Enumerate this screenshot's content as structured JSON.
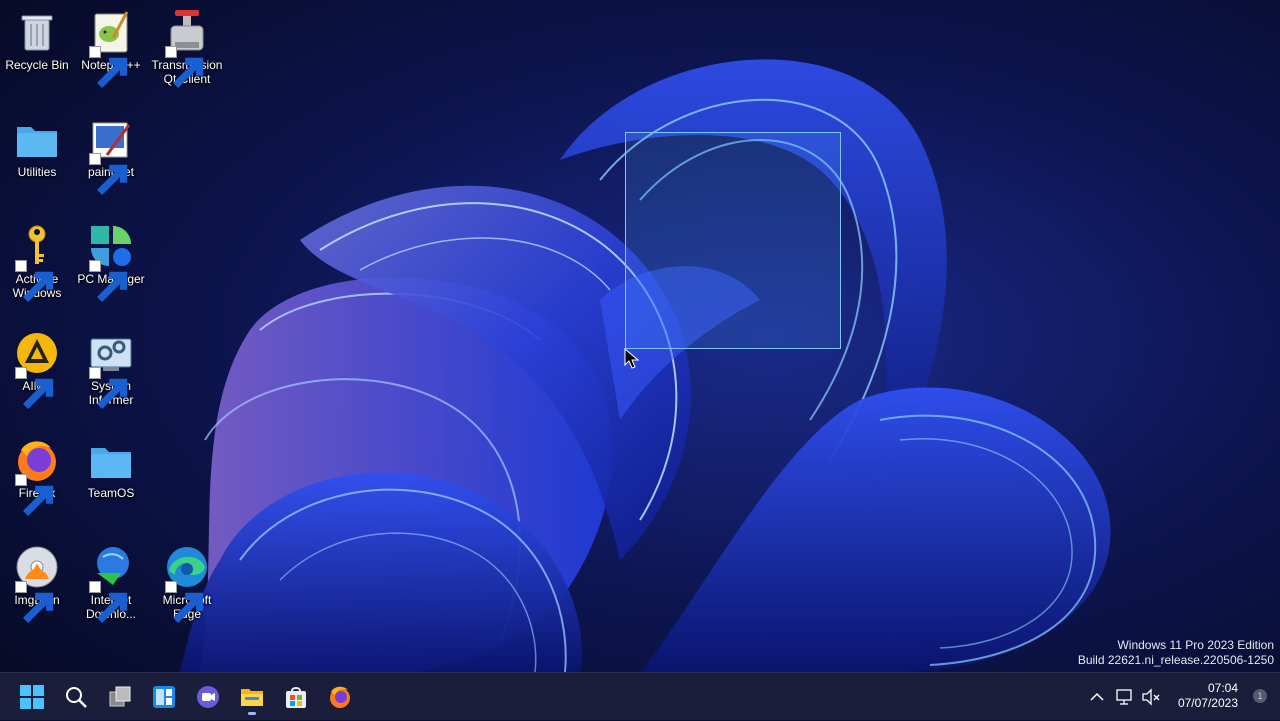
{
  "desktop": {
    "icons": [
      {
        "id": "recycle-bin",
        "label": "Recycle Bin",
        "icon": "recycle-bin-icon"
      },
      {
        "id": "notepadpp",
        "label": "Notepad++",
        "icon": "notepadpp-icon"
      },
      {
        "id": "transmission",
        "label": "Transmission Qt Client",
        "icon": "transmission-icon"
      },
      {
        "id": "utilities",
        "label": "Utilities",
        "icon": "folder-icon"
      },
      {
        "id": "paintnet",
        "label": "paint.net",
        "icon": "paintnet-icon"
      },
      {
        "id": "activate",
        "label": "Activate Windows",
        "icon": "key-icon"
      },
      {
        "id": "pcmanager",
        "label": "PC Manager",
        "icon": "pc-manager-icon"
      },
      {
        "id": "aimp",
        "label": "AIMP",
        "icon": "aimp-icon"
      },
      {
        "id": "sysinformer",
        "label": "System Informer",
        "icon": "system-informer-icon"
      },
      {
        "id": "firefox",
        "label": "Firefox",
        "icon": "firefox-icon"
      },
      {
        "id": "teamos",
        "label": "TeamOS",
        "icon": "folder-icon"
      },
      {
        "id": "imgburn",
        "label": "ImgBurn",
        "icon": "imgburn-icon"
      },
      {
        "id": "idm",
        "label": "Internet Downlo...",
        "icon": "idm-icon"
      },
      {
        "id": "edge",
        "label": "Microsoft Edge",
        "icon": "edge-icon"
      }
    ]
  },
  "watermark": {
    "line1": "Windows 11 Pro 2023 Edition",
    "line2": "Build 22621.ni_release.220506-1250"
  },
  "taskbar": {
    "pinned": [
      "start-icon",
      "search-icon",
      "task-view-icon",
      "widgets-icon",
      "chat-icon",
      "file-explorer-icon",
      "microsoft-store-icon",
      "firefox-icon"
    ],
    "tray": [
      "chevron-up-icon",
      "network-icon",
      "volume-muted-icon"
    ],
    "clock": {
      "time": "07:04",
      "date": "07/07/2023"
    },
    "notifications": "1"
  },
  "colors": {
    "accent": "#3a6bff",
    "taskbar": "#1a1e3a",
    "folder": "#5cb8f2"
  }
}
